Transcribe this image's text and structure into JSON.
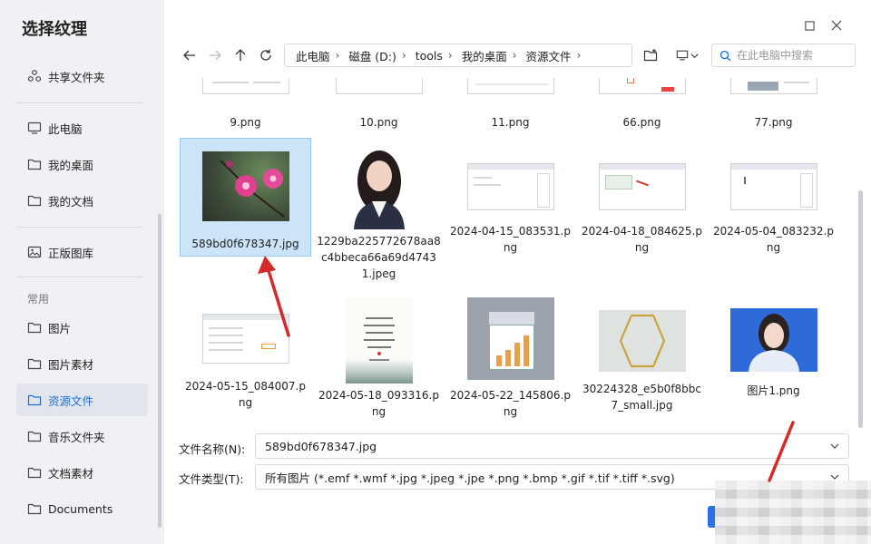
{
  "dialog": {
    "title": "选择纹理"
  },
  "sidebar": {
    "items": [
      {
        "label": "共享文件夹",
        "icon": "shared-folder-icon"
      },
      {
        "label": "此电脑",
        "icon": "computer-icon"
      },
      {
        "label": "我的桌面",
        "icon": "folder-icon"
      },
      {
        "label": "我的文档",
        "icon": "folder-icon"
      },
      {
        "label": "正版图库",
        "icon": "gallery-icon"
      },
      {
        "label": "图片",
        "icon": "folder-icon"
      },
      {
        "label": "图片素材",
        "icon": "folder-icon"
      },
      {
        "label": "资源文件",
        "icon": "folder-icon",
        "active": true
      },
      {
        "label": "音乐文件夹",
        "icon": "folder-icon"
      },
      {
        "label": "文档素材",
        "icon": "folder-icon"
      },
      {
        "label": "Documents",
        "icon": "folder-icon"
      }
    ],
    "section_label": "常用"
  },
  "breadcrumb": [
    "此电脑",
    "磁盘 (D:)",
    "tools",
    "我的桌面",
    "资源文件"
  ],
  "search": {
    "placeholder": "在此电脑中搜索"
  },
  "files": [
    {
      "name": "9.png"
    },
    {
      "name": "10.png"
    },
    {
      "name": "11.png"
    },
    {
      "name": "66.png"
    },
    {
      "name": "77.png"
    },
    {
      "name": "589bd0f678347.jpg",
      "selected": true
    },
    {
      "name": "1229ba225772678aa8c4bbeca66a69d47431.jpeg"
    },
    {
      "name": "2024-04-15_083531.png"
    },
    {
      "name": "2024-04-18_084625.png"
    },
    {
      "name": "2024-05-04_083232.png"
    },
    {
      "name": "2024-05-15_084007.png"
    },
    {
      "name": "2024-05-18_093316.png"
    },
    {
      "name": "2024-05-22_145806.png"
    },
    {
      "name": "30224328_e5b0f8bbc7_small.jpg"
    },
    {
      "name": "图片1.png"
    }
  ],
  "filename_field": {
    "label": "文件名称(N):",
    "value": "589bd0f678347.jpg"
  },
  "filetype_field": {
    "label": "文件类型(T):",
    "value": "所有图片 (*.emf *.wmf *.jpg *.jpeg *.jpe *.png *.bmp *.gif *.tif *.tiff *.svg)"
  },
  "colors": {
    "accent": "#1c6fd6",
    "selected_bg": "#cce4f7",
    "arrow": "#d42a2a"
  }
}
